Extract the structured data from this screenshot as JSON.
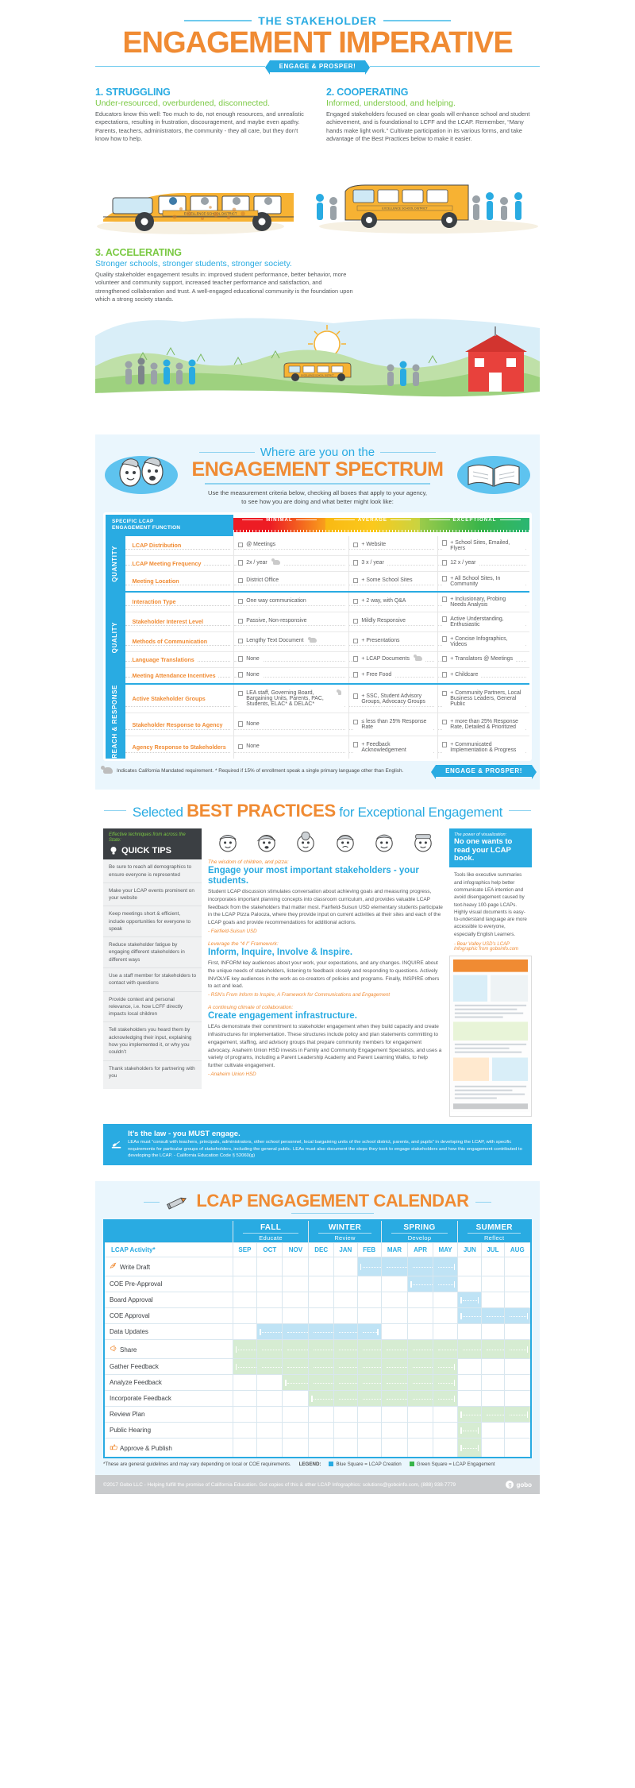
{
  "header": {
    "kicker": "THE STAKEHOLDER",
    "title": "ENGAGEMENT IMPERATIVE",
    "pill": "ENGAGE & PROSPER!"
  },
  "stages": [
    {
      "heading": "1. STRUGGLING",
      "lede": "Under-resourced, overburdened, disconnected.",
      "body": "Educators know this well: Too much to do, not enough resources, and unrealistic expectations, resulting in frustration, discouragement, and maybe even apathy. Parents, teachers, administrators, the community - they all care, but they don't know how to help."
    },
    {
      "heading": "2. COOPERATING",
      "lede": "Informed, understood, and helping.",
      "body": "Engaged stakeholders focused on clear goals will enhance school and student achievement, and is foundational to LCFF and the LCAP. Remember, “Many hands make light work.” Cultivate participation in its various forms, and take advantage of the Best Practices below to make it easier."
    },
    {
      "heading": "3. ACCELERATING",
      "lede": "Stronger schools, stronger students, stronger society.",
      "body": "Quality stakeholder engagement results in: improved student performance, better behavior, more volunteer and community support, increased teacher performance and satisfaction, and strengthened collaboration and trust. A well-engaged educational community is the foundation upon which a strong society stands."
    }
  ],
  "spectrum": {
    "kicker": "Where are you on the",
    "title": "ENGAGEMENT SPECTRUM",
    "instruction_line1": "Use the measurement criteria below, checking all boxes that apply to your agency,",
    "instruction_line2": "to see how you are doing and what better might look like:",
    "col_header": "SPECIFIC LCAP\nENGAGEMENT FUNCTION",
    "col_header_line1": "SPECIFIC LCAP",
    "col_header_line2": "ENGAGEMENT FUNCTION",
    "levels": [
      "MINIMAL",
      "AVERAGE",
      "EXCEPTIONAL"
    ],
    "sections": [
      {
        "label": "QUANTITY",
        "rows": [
          {
            "name": "LCAP Distribution",
            "minimal": "@ Meetings",
            "minimal_bear": false,
            "average": "+ Website",
            "exceptional": "+ School Sites, Emailed, Flyers"
          },
          {
            "name": "LCAP Meeting Frequency",
            "minimal": "2x / year",
            "minimal_bear": true,
            "average": "3 x / year",
            "exceptional": "12 x / year"
          },
          {
            "name": "Meeting Location",
            "minimal": "District Office",
            "minimal_bear": false,
            "average": "+ Some School Sites",
            "exceptional": "+ All School Sites, In Community"
          }
        ]
      },
      {
        "label": "QUALITY",
        "rows": [
          {
            "name": "Interaction Type",
            "minimal": "One way communication",
            "minimal_bear": false,
            "average": "+ 2 way, with Q&A",
            "exceptional": "+ Inclusionary, Probing Needs Analysis"
          },
          {
            "name": "Stakeholder Interest Level",
            "minimal": "Passive, Non-responsive",
            "minimal_bear": false,
            "average": "Mildly Responsive",
            "exceptional": "Active Understanding, Enthusiastic"
          },
          {
            "name": "Methods of Communication",
            "minimal": "Lengthy Text Document",
            "minimal_bear": true,
            "average": "+ Presentations",
            "exceptional": "+ Concise Infographics, Videos"
          },
          {
            "name": "Language Translations",
            "minimal": "None",
            "minimal_bear": false,
            "average": "+ LCAP Documents",
            "average_bear": true,
            "exceptional": "+ Translators @ Meetings"
          },
          {
            "name": "Meeting Attendance Incentives",
            "minimal": "None",
            "minimal_bear": false,
            "average": "+ Free Food",
            "exceptional": "+ Childcare"
          }
        ]
      },
      {
        "label": "REACH &\nRESPONSE",
        "label_line1": "REACH &",
        "label_line2": "RESPONSE",
        "rows": [
          {
            "name": "Active Stakeholder Groups",
            "minimal": "LEA staff, Governing Board, Bargaining Units, Parents, PAC, Students, ELAC* & DELAC*",
            "minimal_bear": true,
            "average": "+ SSC, Student Advisory Groups, Advocacy Groups",
            "exceptional": "+ Community Partners, Local Business Leaders, General Public"
          },
          {
            "name": "Stakeholder Response to Agency",
            "minimal": "None",
            "minimal_bear": false,
            "average": "≤ less than 25% Response Rate",
            "exceptional": "+ more than 25% Response Rate, Detailed & Prioritized"
          },
          {
            "name": "Agency Response to Stakeholders",
            "minimal": "None",
            "minimal_bear": false,
            "average": "+ Feedback Acknowledgement",
            "exceptional": "+ Communicated Implementation & Progress"
          }
        ]
      }
    ],
    "footnote": "Indicates California Mandated requirement. * Required if 15% of enrollment speak a single primary language other than English.",
    "foot_pill": "ENGAGE & PROSPER!"
  },
  "best_practices": {
    "title_1": "Selected",
    "title_2": "BEST PRACTICES",
    "title_3": "for Exceptional Engagement",
    "quick_tips": {
      "kicker": "Effective techniques from across the State:",
      "title": "QUICK TIPS",
      "items": [
        "Be sure to reach all demographics to ensure everyone is represented",
        "Make your LCAP events prominent on your website",
        "Keep meetings short & efficient, include opportunities for everyone to speak",
        "Reduce stakeholder fatigue by engaging different stakeholders in different ways",
        "Use a staff member for stakeholders to contact with questions",
        "Provide context and personal relevance, i.e. how LCFF directly impacts local children",
        "Tell stakeholders you heard them by acknowledging their input, explaining how you implemented it, or why you couldn’t",
        "Thank stakeholders for partnering with you"
      ]
    },
    "practices": [
      {
        "kicker": "The wisdom of children, and pizza:",
        "title": "Engage your most important stakeholders - your students.",
        "body": "Student LCAP discussion stimulates conversation about achieving goals and measuring progress, incorporates important planning concepts into classroom curriculum, and provides valuable LCAP feedback from the stakeholders that matter most. Fairfield-Suisun USD elementary students participate in the LCAP Pizza Palooza, where they provide input on current activities at their sites and each of the LCAP goals and provide recommendations for additional actions.",
        "source": "- Fairfield-Suisun USD"
      },
      {
        "kicker": "Leverage the “4 I” Framework:",
        "title": "Inform, Inquire, Involve & Inspire.",
        "body": "First, INFORM key audiences about your work, your expectations, and any changes. INQUIRE about the unique needs of stakeholders, listening to feedback closely and responding to questions. Actively INVOLVE key audiences in the work as co-creators of policies and programs. Finally, INSPIRE others to act and lead.",
        "source": "- RSN’s From Inform to Inspire, A Framework for Communications and Engagement"
      },
      {
        "kicker": "A continuing climate of collaboration:",
        "title": "Create engagement infrastructure.",
        "body": "LEAs demonstrate their commitment to stakeholder engagement when they build capacity and create infrastructures for implementation. These structures include policy and plan statements committing to engagement, staffing, and advisory groups that prepare community members for engagement advocacy. Anaheim Union HSD invests in Family and Community Engagement Specialists, and uses a variety of programs, including a Parent Leadership Academy and Parent Learning Walks, to help further cultivate engagement.",
        "source": "- Anaheim Union HSD"
      }
    ],
    "viz": {
      "kicker": "The power of visualization:",
      "title": "No one wants to read your LCAP book.",
      "body": "Tools like executive summaries and infographics help better communicate LEA intention and avoid disengagement caused by text-heavy 100-page LCAPs. Highly visual documents is easy-to-understand language are more accessible to everyone, especially English Learners.",
      "source": "- Bear Valley USD’s LCAP Infographic from goboinfo.com"
    },
    "law": {
      "title": "It’s the law - you MUST engage.",
      "body": "LEAs must “consult with teachers, principals, administrators, other school personnel, local bargaining units of the school district, parents, and pupils” in developing the LCAP, with specific requirements for particular groups of stakeholders, including the general public. LEAs must also document the steps they took to engage stakeholders and how this engagement contributed to developing the LCAP. - California Education Code § 52060(g)"
    }
  },
  "calendar": {
    "title": "LCAP ENGAGEMENT CALENDAR",
    "seasons": [
      {
        "name": "FALL",
        "sub": "Educate",
        "months": [
          "SEP",
          "OCT",
          "NOV"
        ]
      },
      {
        "name": "WINTER",
        "sub": "Review",
        "months": [
          "DEC",
          "JAN",
          "FEB"
        ]
      },
      {
        "name": "SPRING",
        "sub": "Develop",
        "months": [
          "MAR",
          "APR",
          "MAY"
        ]
      },
      {
        "name": "SUMMER",
        "sub": "Reflect",
        "months": [
          "JUN",
          "JUL",
          "AUG"
        ]
      }
    ],
    "activity_header": "LCAP Activity*",
    "rows": [
      {
        "name": "Write Draft",
        "icon": "pen-icon",
        "color": "blue",
        "start": 5,
        "end": 8
      },
      {
        "name": "COE Pre-Approval",
        "icon": "",
        "color": "blue",
        "start": 7,
        "end": 8
      },
      {
        "name": "Board Approval",
        "icon": "",
        "color": "blue",
        "start": 9,
        "end": 9
      },
      {
        "name": "COE Approval",
        "icon": "",
        "color": "blue",
        "start": 9,
        "end": 11
      },
      {
        "name": "Data Updates",
        "icon": "",
        "color": "blue",
        "start": 1,
        "end": 5
      },
      {
        "name": "Share",
        "icon": "megaphone-icon",
        "color": "green",
        "start": 0,
        "end": 11
      },
      {
        "name": "Gather Feedback",
        "icon": "",
        "color": "green",
        "start": 0,
        "end": 8
      },
      {
        "name": "Analyze Feedback",
        "icon": "",
        "color": "green",
        "start": 2,
        "end": 8
      },
      {
        "name": "Incorporate Feedback",
        "icon": "",
        "color": "green",
        "start": 3,
        "end": 8
      },
      {
        "name": "Review Plan",
        "icon": "",
        "color": "green",
        "start": 9,
        "end": 11
      },
      {
        "name": "Public Hearing",
        "icon": "",
        "color": "green",
        "start": 9,
        "end": 9
      },
      {
        "name": "Approve & Publish",
        "icon": "thumbsup-icon",
        "color": "green",
        "start": 9,
        "end": 9
      }
    ],
    "footnote": "*These are general guidelines and may vary depending on local or COE requirements.",
    "legend_label": "LEGEND:",
    "legend_blue": "Blue Square = LCAP Creation",
    "legend_green": "Green Square = LCAP Engagement"
  },
  "footer": {
    "copyright": "©2017 Gobo LLC - Helping fulfill the promise of California Education. Get copies of this & other LCAP Infographics: solutions@goboinfo.com, (888) 938-7779",
    "brand": "gobo"
  },
  "colors": {
    "blue": "#29abe2",
    "orange": "#f08b33",
    "green": "#7ac943",
    "red": "#ed1c24",
    "yellow": "#f9b913",
    "dark": "#3b3f43"
  },
  "bus_text": "EXCELLENCE SCHOOL DISTRICT"
}
